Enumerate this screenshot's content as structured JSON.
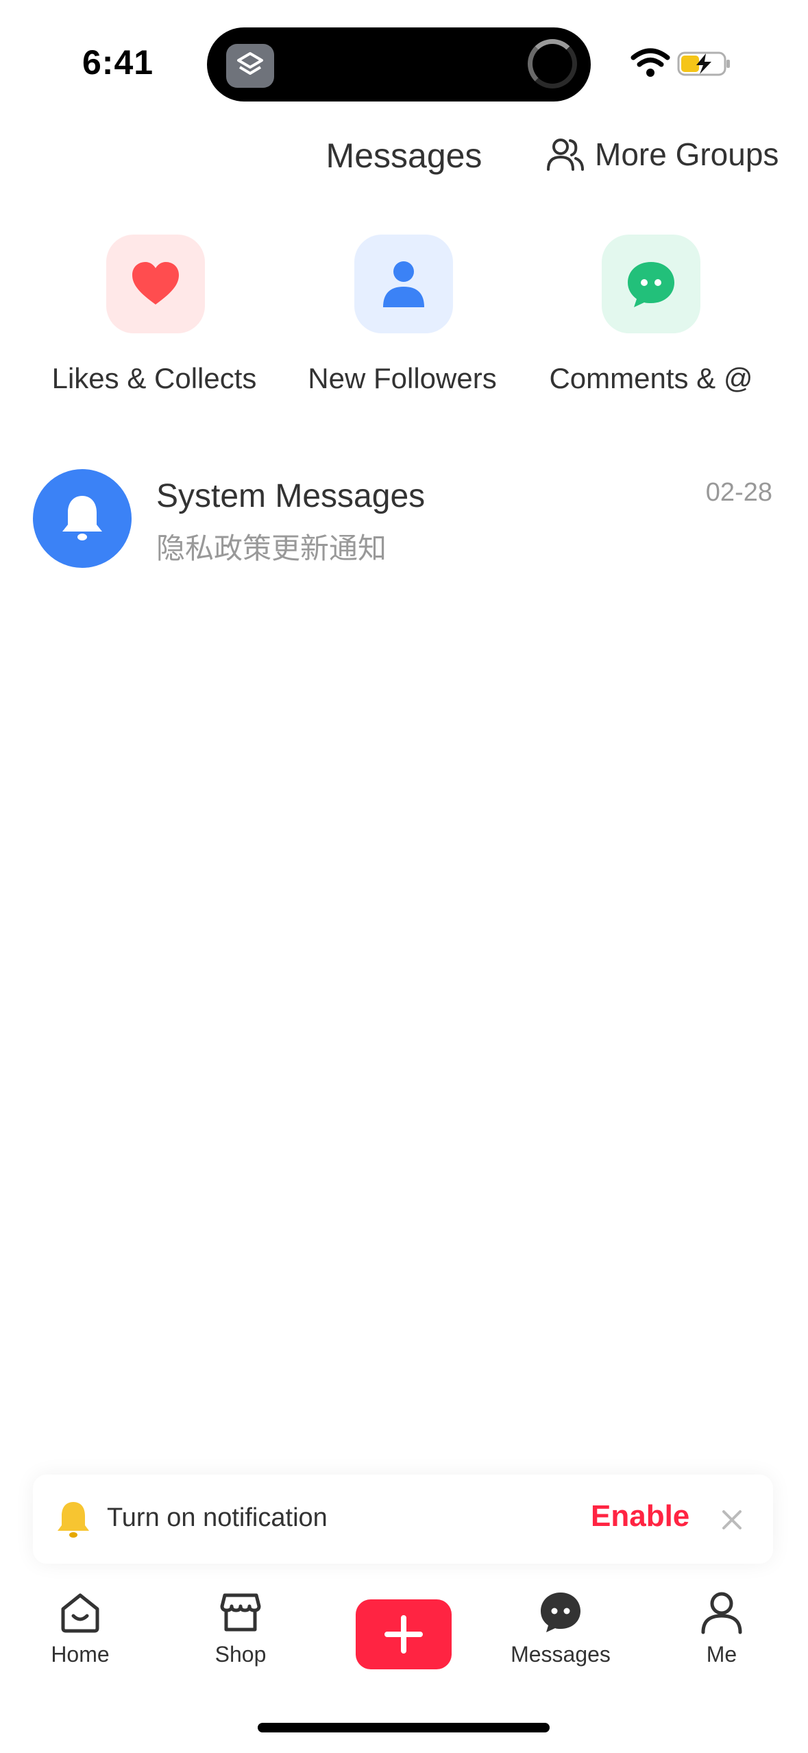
{
  "status_bar": {
    "time": "6:41"
  },
  "header": {
    "title": "Messages",
    "more_groups": "More Groups"
  },
  "categories": [
    {
      "label": "Likes & Collects",
      "icon": "heart-icon",
      "color": "#ff4d4f",
      "bg": "#ffe8e8"
    },
    {
      "label": "New Followers",
      "icon": "person-icon",
      "color": "#3b82f6",
      "bg": "#e6efff"
    },
    {
      "label": "Comments & @",
      "icon": "chat-icon",
      "color": "#22c07a",
      "bg": "#e3f8ee"
    }
  ],
  "system_messages": {
    "title": "System Messages",
    "subtitle": "隐私政策更新通知",
    "date": "02-28",
    "avatar_color": "#3b82f6"
  },
  "notification_banner": {
    "text": "Turn on notification",
    "action": "Enable",
    "accent": "#ff2442"
  },
  "tab_bar": {
    "home": "Home",
    "shop": "Shop",
    "messages": "Messages",
    "me": "Me"
  }
}
